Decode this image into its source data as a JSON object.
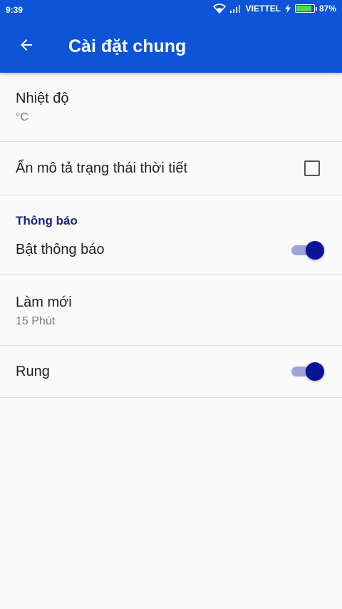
{
  "statusbar": {
    "time": "9:39",
    "carrier": "VIETTEL",
    "battery": "87%",
    "icons": [
      "wifi-icon",
      "signal-icon",
      "charging-icon",
      "battery-icon"
    ]
  },
  "appbar": {
    "title": "Cài đặt chung",
    "back_icon": "arrow-back-icon",
    "color": "#0d55d6"
  },
  "settings": {
    "temperature": {
      "label": "Nhiệt độ",
      "value": "°C"
    },
    "hide_description": {
      "label": "Ẩn mô tả trạng thái thời tiết",
      "checked": false
    },
    "notifications_section": {
      "title": "Thông báo"
    },
    "enable_notifications": {
      "label": "Bật thông báo",
      "on": true
    },
    "refresh": {
      "label": "Làm mới",
      "value": "15 Phút"
    },
    "vibrate": {
      "label": "Rung",
      "on": true
    }
  },
  "colors": {
    "accent": "#0a1496",
    "section_title": "#1a237e"
  }
}
